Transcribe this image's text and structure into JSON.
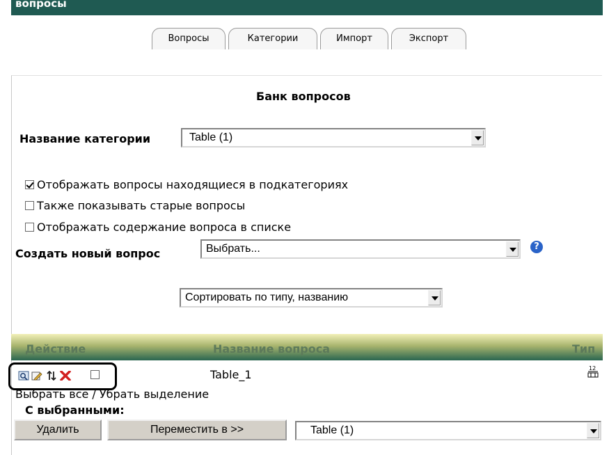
{
  "header": {
    "title": "вопросы"
  },
  "tabs": [
    "Вопросы",
    "Категории",
    "Импорт",
    "Экспорт"
  ],
  "bank": {
    "title": "Банк вопросов",
    "category_label": "Название категории",
    "category_value": "Table (1)",
    "options": [
      {
        "label": "Отображать вопросы находящиеся в подкатегориях",
        "checked": true
      },
      {
        "label": "Также показывать старые вопросы",
        "checked": false
      },
      {
        "label": "Отображать содержание вопроса в списке",
        "checked": false
      }
    ],
    "create_label": "Создать новый вопрос",
    "create_value": "Выбрать...",
    "sort_value": "Сортировать по типу, названию"
  },
  "table": {
    "headers": {
      "action": "Действие",
      "name": "Название вопроса",
      "type": "Тип"
    },
    "rows": [
      {
        "name": "Table_1",
        "type_icon": "matching-type-icon",
        "selected": false
      }
    ]
  },
  "selection": {
    "select_all": "Выбрать все",
    "separator": " / ",
    "deselect": "Убрать выделение"
  },
  "with_selected": {
    "label": "С выбранными:",
    "delete_button": "Удалить",
    "move_button": "Переместить в >>",
    "move_target": "Table (1)"
  },
  "colors": {
    "header_bar": "#1f5a52",
    "table_header_gradient_top": "#f2f0b8",
    "table_header_gradient_bottom": "#2a6650",
    "help_icon": "#2a63c8",
    "delete_icon": "#d21f1f"
  }
}
